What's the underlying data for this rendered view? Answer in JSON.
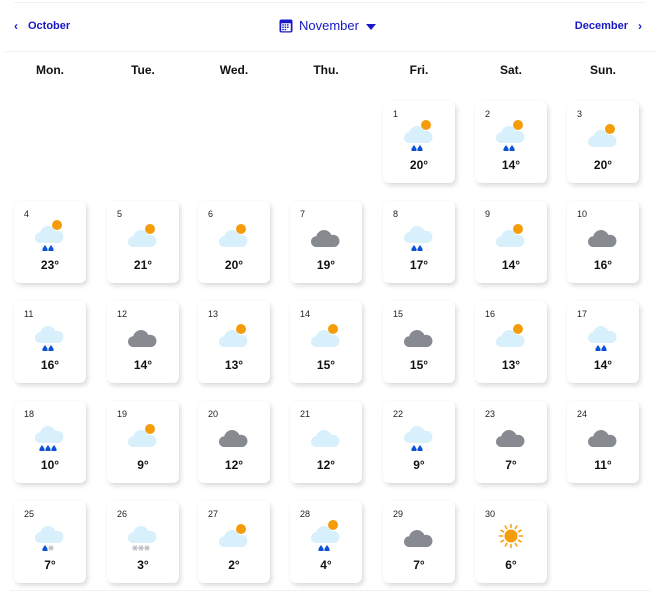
{
  "nav": {
    "prev_label": "October",
    "current_label": "November",
    "next_label": "December",
    "prev_icon": "chevron-left-icon",
    "next_icon": "chevron-right-icon",
    "calendar_icon": "calendar-icon",
    "dropdown_icon": "caret-down-icon",
    "accent_color": "#1818c8"
  },
  "weekdays": [
    "Mon.",
    "Tue.",
    "Wed.",
    "Thu.",
    "Fri.",
    "Sat.",
    "Sun."
  ],
  "first_weekday_index": 4,
  "days": [
    {
      "day": "1",
      "temp": "20°",
      "condition": "partly-cloudy-rain"
    },
    {
      "day": "2",
      "temp": "14°",
      "condition": "partly-cloudy-rain"
    },
    {
      "day": "3",
      "temp": "20°",
      "condition": "partly-cloudy"
    },
    {
      "day": "4",
      "temp": "23°",
      "condition": "partly-cloudy-rain"
    },
    {
      "day": "5",
      "temp": "21°",
      "condition": "partly-cloudy"
    },
    {
      "day": "6",
      "temp": "20°",
      "condition": "partly-cloudy"
    },
    {
      "day": "7",
      "temp": "19°",
      "condition": "overcast"
    },
    {
      "day": "8",
      "temp": "17°",
      "condition": "rain"
    },
    {
      "day": "9",
      "temp": "14°",
      "condition": "partly-cloudy"
    },
    {
      "day": "10",
      "temp": "16°",
      "condition": "overcast"
    },
    {
      "day": "11",
      "temp": "16°",
      "condition": "rain"
    },
    {
      "day": "12",
      "temp": "14°",
      "condition": "overcast"
    },
    {
      "day": "13",
      "temp": "13°",
      "condition": "partly-cloudy"
    },
    {
      "day": "14",
      "temp": "15°",
      "condition": "partly-cloudy"
    },
    {
      "day": "15",
      "temp": "15°",
      "condition": "overcast"
    },
    {
      "day": "16",
      "temp": "13°",
      "condition": "partly-cloudy"
    },
    {
      "day": "17",
      "temp": "14°",
      "condition": "rain"
    },
    {
      "day": "18",
      "temp": "10°",
      "condition": "heavy-rain"
    },
    {
      "day": "19",
      "temp": "9°",
      "condition": "partly-cloudy"
    },
    {
      "day": "20",
      "temp": "12°",
      "condition": "overcast"
    },
    {
      "day": "21",
      "temp": "12°",
      "condition": "cloudy"
    },
    {
      "day": "22",
      "temp": "9°",
      "condition": "rain"
    },
    {
      "day": "23",
      "temp": "7°",
      "condition": "overcast"
    },
    {
      "day": "24",
      "temp": "11°",
      "condition": "overcast"
    },
    {
      "day": "25",
      "temp": "7°",
      "condition": "sleet"
    },
    {
      "day": "26",
      "temp": "3°",
      "condition": "snow"
    },
    {
      "day": "27",
      "temp": "2°",
      "condition": "partly-cloudy"
    },
    {
      "day": "28",
      "temp": "4°",
      "condition": "partly-cloudy-rain"
    },
    {
      "day": "29",
      "temp": "7°",
      "condition": "overcast"
    },
    {
      "day": "30",
      "temp": "6°",
      "condition": "sunny"
    }
  ],
  "colors": {
    "light_cloud": "#d8f0fb",
    "dark_cloud": "#878b91",
    "sun": "#f59c0b",
    "rain": "#0b52d6",
    "snow": "#b8bcc4"
  }
}
